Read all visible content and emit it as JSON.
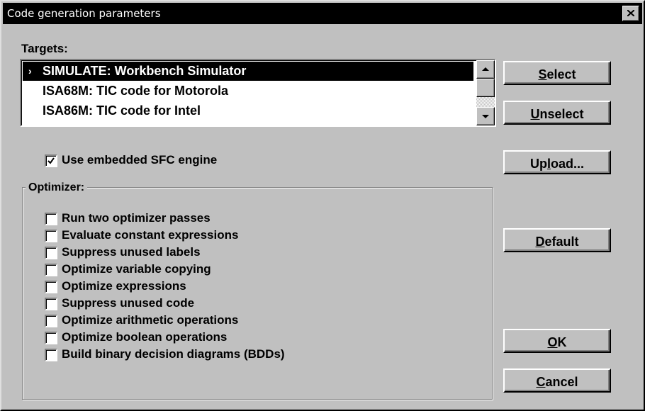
{
  "window": {
    "title": "Code generation parameters",
    "close_icon": "close-icon"
  },
  "targets": {
    "label": "Targets:",
    "items": [
      {
        "text": "SIMULATE: Workbench Simulator",
        "selected": true
      },
      {
        "text": "ISA68M: TIC code for Motorola",
        "selected": false
      },
      {
        "text": "ISA86M: TIC code for Intel",
        "selected": false
      }
    ]
  },
  "embedded_sfc": {
    "label": "Use embedded SFC engine",
    "checked": true
  },
  "optimizer": {
    "title": "Optimizer:",
    "options": [
      {
        "label": "Run two optimizer passes",
        "checked": false
      },
      {
        "label": "Evaluate constant expressions",
        "checked": false
      },
      {
        "label": "Suppress unused labels",
        "checked": false
      },
      {
        "label": "Optimize variable copying",
        "checked": false
      },
      {
        "label": "Optimize expressions",
        "checked": false
      },
      {
        "label": "Suppress unused code",
        "checked": false
      },
      {
        "label": "Optimize arithmetic operations",
        "checked": false
      },
      {
        "label": "Optimize boolean operations",
        "checked": false
      },
      {
        "label": "Build binary decision diagrams (BDDs)",
        "checked": false
      }
    ]
  },
  "buttons": {
    "select": {
      "acc": "S",
      "rest": "elect"
    },
    "unselect": {
      "acc": "U",
      "rest": "nselect"
    },
    "upload": {
      "pre": "Up",
      "acc": "l",
      "rest": "oad..."
    },
    "default": {
      "acc": "D",
      "rest": "efault"
    },
    "ok": {
      "acc": "O",
      "rest": "K"
    },
    "cancel": {
      "acc": "C",
      "rest": "ancel"
    }
  }
}
